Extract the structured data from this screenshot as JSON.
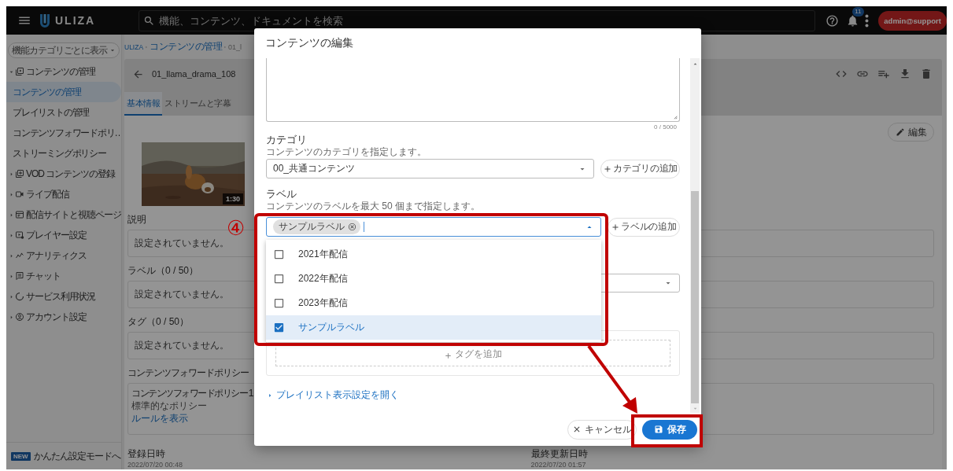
{
  "topbar": {
    "logo": "ULIZA",
    "search": {
      "placeholder": "機能、コンテンツ、ドキュメントを検索"
    },
    "notification_count": "11",
    "user_button": "admin@support"
  },
  "sidebar": {
    "view_toggle": "機能カテゴリごとに表示",
    "items": [
      {
        "label": "コンテンツの管理",
        "expanded": true,
        "children": [
          {
            "label": "コンテンツの管理",
            "selected": true
          },
          {
            "label": "プレイリストの管理",
            "selected": false
          },
          {
            "label": "コンテンツフォワードポリ…",
            "selected": false
          },
          {
            "label": "ストリーミングポリシー",
            "selected": false
          }
        ]
      },
      {
        "label": "VOD コンテンツの登録",
        "expanded": false
      },
      {
        "label": "ライブ配信",
        "expanded": false
      },
      {
        "label": "配信サイトと視聴ページ",
        "expanded": false
      },
      {
        "label": "プレイヤー設定",
        "expanded": false
      },
      {
        "label": "アナリティクス",
        "expanded": false
      },
      {
        "label": "チャット",
        "expanded": false
      },
      {
        "label": "サービス利用状況",
        "expanded": false
      },
      {
        "label": "アカウント設定",
        "expanded": false
      }
    ],
    "new_mode": {
      "badge": "NEW",
      "label": "かんたん設定モードへ"
    }
  },
  "breadcrumb": [
    "ULIZA",
    "コンテンツの管理",
    "01_l"
  ],
  "content_header": {
    "title": "01_llama_drama_108",
    "tabs": [
      {
        "label": "基本情報",
        "selected": true
      },
      {
        "label": "ストリームと字幕",
        "selected": false
      }
    ]
  },
  "details": {
    "edit_button": "編集",
    "thumbnail": {
      "kind": "picture",
      "duration": "1:30"
    },
    "fields": [
      {
        "label": "説明",
        "value": "設定されていません。"
      },
      {
        "label": "ラベル（0 / 50）",
        "value": "設定されていません。"
      },
      {
        "label": "タグ（0 / 50）",
        "value": "設定されていません。"
      }
    ],
    "policy": {
      "label": "コンテンツフォワードポリシー",
      "name": "コンテンツフォワードポリシー 1",
      "description": "標準的なポリシー",
      "link": "ルールを表示"
    },
    "created": {
      "label": "登録日時",
      "value": "2022/07/20 00:48"
    },
    "updated": {
      "label": "最終更新日時",
      "value": "2022/07/20 01:57"
    }
  },
  "dialog": {
    "title": "コンテンツの編集",
    "description_counter": "0 / 5000",
    "category": {
      "label": "カテゴリ",
      "hint": "コンテンツのカテゴリを指定します。",
      "value": "00_共通コンテンツ",
      "add_button": "カテゴリの追加"
    },
    "labels": {
      "label": "ラベル",
      "hint": "コンテンツのラベルを最大 50 個まで指定します。",
      "chips": [
        "サンプルラベル"
      ],
      "expanded": true,
      "add_button": "ラベルの追加",
      "options": [
        {
          "label": "2021年配信",
          "checked": false,
          "selected": false
        },
        {
          "label": "2022年配信",
          "checked": false,
          "selected": false
        },
        {
          "label": "2023年配信",
          "checked": false,
          "selected": false
        },
        {
          "label": "サンプルラベル",
          "checked": true,
          "selected": true
        }
      ]
    },
    "tags": {
      "add_button": "タグを追加"
    },
    "playlist_toggle": "プレイリスト表示設定を開く",
    "cancel_button": "キャンセル",
    "save_button": "保存"
  },
  "annotation": {
    "step": "④"
  }
}
